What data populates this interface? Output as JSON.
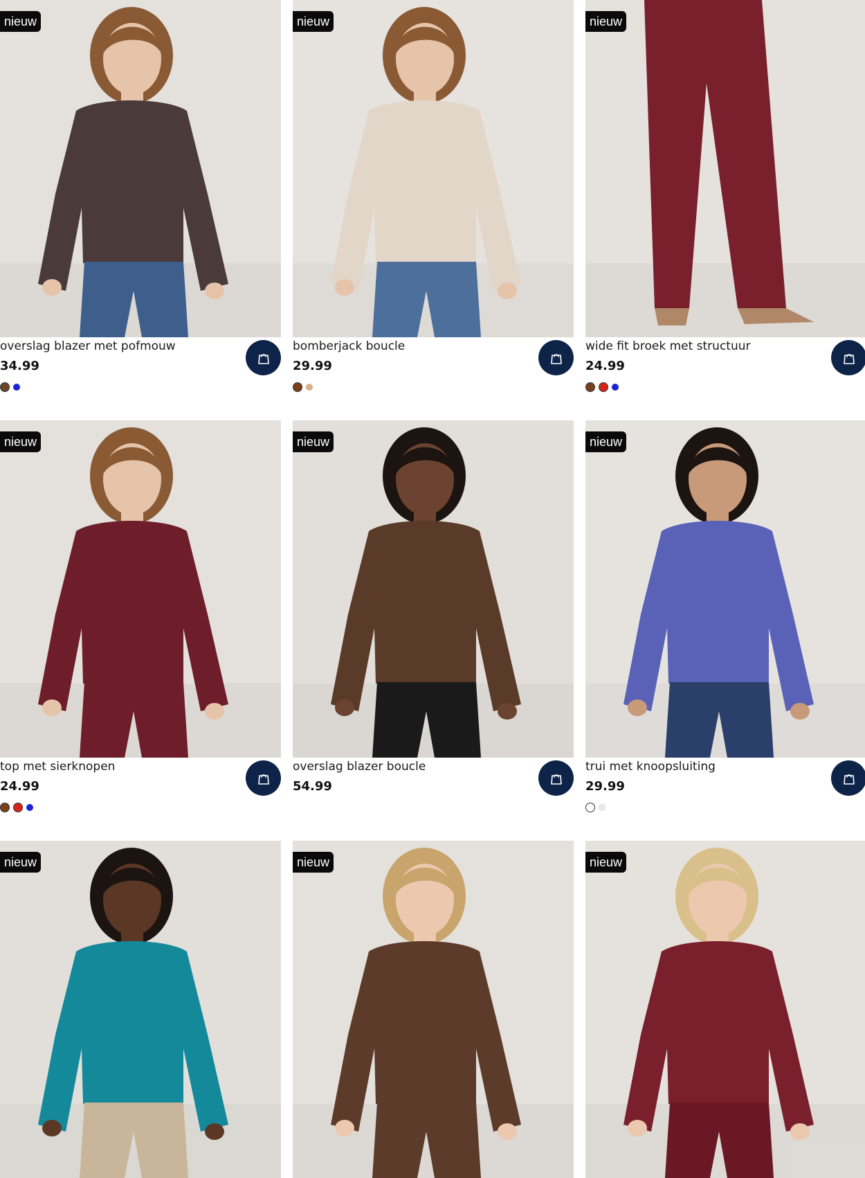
{
  "products": [
    {
      "badge": "nieuw",
      "title": "overslag blazer met pofmouw",
      "price": "34.99",
      "swatches": [
        "#6b4423",
        "#1a24d6"
      ],
      "bg": "#e4e0db",
      "garment": "#4a3a3a",
      "pants": "#3e5f8c",
      "skin": "#e6c4aa",
      "hair": "#8a5a35"
    },
    {
      "badge": "nieuw",
      "title": "bomberjack boucle",
      "price": "29.99",
      "swatches": [
        "#7a3f1a",
        "#d9b08c"
      ],
      "bg": "#e6e2dd",
      "garment": "#e2d6c8",
      "pants": "#4c6f9c",
      "skin": "#e6c4aa",
      "hair": "#8a5a35"
    },
    {
      "badge": "nieuw",
      "title": "wide fit broek met structuur",
      "price": "24.99",
      "swatches": [
        "#7a3f1a",
        "#d6241a",
        "#1a24d6"
      ],
      "bg": "#e5e1dc",
      "garment": "#7a1f2c",
      "pants": "#7a1f2c",
      "skin": "#c89a7a",
      "hair": "#7a1f2c"
    },
    {
      "badge": "nieuw",
      "title": "top met sierknopen",
      "price": "24.99",
      "swatches": [
        "#7a3f1a",
        "#d6241a",
        "#1a24d6"
      ],
      "bg": "#e4e0db",
      "garment": "#6e1d2a",
      "pants": "#6e1d2a",
      "skin": "#e6c4aa",
      "hair": "#8a5a35"
    },
    {
      "badge": "nieuw",
      "title": "overslag blazer boucle",
      "price": "54.99",
      "swatches": [],
      "bg": "#e2ded9",
      "garment": "#5a3a28",
      "pants": "#1a1a1a",
      "skin": "#6b4330",
      "hair": "#1c1410"
    },
    {
      "badge": "nieuw",
      "title": "trui met knoopsluiting",
      "price": "29.99",
      "swatches": [
        "#ffffff",
        "#e8e8e8"
      ],
      "bg": "#e6e3df",
      "garment": "#5a62b8",
      "pants": "#2a3f6a",
      "skin": "#c89a7a",
      "hair": "#1c1410"
    },
    {
      "badge": "nieuw",
      "title": "",
      "price": "",
      "swatches": [],
      "bg": "#e2dfda",
      "garment": "#13899a",
      "pants": "#c9b69a",
      "skin": "#5b3826",
      "hair": "#1c1410"
    },
    {
      "badge": "nieuw",
      "title": "",
      "price": "",
      "swatches": [],
      "bg": "#e4e0db",
      "garment": "#5c3b2a",
      "pants": "#5c3b2a",
      "skin": "#ecc8ae",
      "hair": "#c9a46c"
    },
    {
      "badge": "nieuw",
      "title": "",
      "price": "",
      "swatches": [],
      "bg": "#e5e1dc",
      "garment": "#7a1f2c",
      "pants": "#6a1824",
      "skin": "#ecc8ae",
      "hair": "#d9c08a"
    }
  ],
  "icons": {
    "cart": "shopping-bag-icon"
  }
}
